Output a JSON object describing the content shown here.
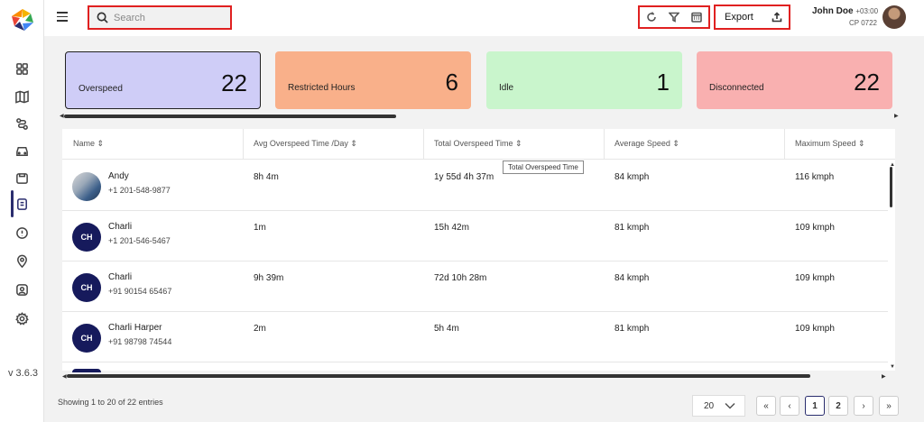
{
  "sidebar": {
    "items": [
      {
        "icon": "dashboard-icon"
      },
      {
        "icon": "map-icon"
      },
      {
        "icon": "route-icon"
      },
      {
        "icon": "vehicle-icon"
      },
      {
        "icon": "fuel-icon"
      },
      {
        "icon": "reports-icon"
      },
      {
        "icon": "alert-icon"
      },
      {
        "icon": "location-icon"
      },
      {
        "icon": "user-icon"
      },
      {
        "icon": "settings-icon"
      }
    ],
    "version": "v 3.6.3"
  },
  "header": {
    "search_placeholder": "Search",
    "export_label": "Export",
    "user_name": "John Doe",
    "user_timezone": "+03:00",
    "user_id": "CP 0722"
  },
  "cards": [
    {
      "label": "Overspeed",
      "value": "22"
    },
    {
      "label": "Restricted Hours",
      "value": "6"
    },
    {
      "label": "Idle",
      "value": "1"
    },
    {
      "label": "Disconnected",
      "value": "22"
    }
  ],
  "table": {
    "columns": [
      "Name",
      "Avg Overspeed Time /Day",
      "Total Overspeed Time",
      "Average Speed",
      "Maximum Speed"
    ],
    "rows": [
      {
        "initials": "",
        "name": "Andy",
        "phone": "+1 201-548-9877",
        "avg": "8h 4m",
        "total": "1y 55d 4h 37m",
        "avg_speed": "84 kmph",
        "max_speed": "116 kmph"
      },
      {
        "initials": "CH",
        "name": "Charli",
        "phone": "+1 201-546-5467",
        "avg": "1m",
        "total": "15h 42m",
        "avg_speed": "81 kmph",
        "max_speed": "109 kmph"
      },
      {
        "initials": "CH",
        "name": "Charli",
        "phone": "+91 90154 65467",
        "avg": "9h 39m",
        "total": "72d 10h 28m",
        "avg_speed": "84 kmph",
        "max_speed": "109 kmph"
      },
      {
        "initials": "CH",
        "name": "Charli Harper",
        "phone": "+91 98798 74544",
        "avg": "2m",
        "total": "5h 4m",
        "avg_speed": "81 kmph",
        "max_speed": "109 kmph"
      }
    ],
    "tooltip": "Total Overspeed Time"
  },
  "footer": {
    "info": "Showing 1 to 20 of 22 entries",
    "page_size": "20",
    "pages": [
      "1",
      "2"
    ],
    "current_page": "1"
  }
}
